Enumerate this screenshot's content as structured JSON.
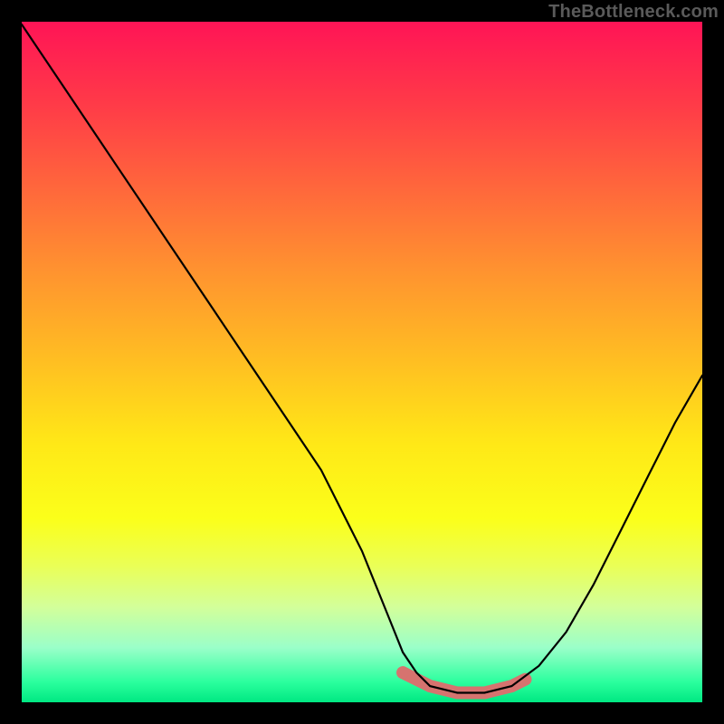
{
  "watermark": "TheBottleneck.com",
  "colors": {
    "background": "#000000",
    "curve": "#000000",
    "highlight": "#d6736f"
  },
  "chart_data": {
    "type": "line",
    "title": "",
    "xlabel": "",
    "ylabel": "",
    "xlim": [
      0,
      100
    ],
    "ylim": [
      0,
      100
    ],
    "grid": false,
    "series": [
      {
        "name": "bottleneck-curve",
        "x": [
          0,
          2,
          6,
          12,
          20,
          28,
          36,
          44,
          50,
          54,
          56,
          58,
          60,
          64,
          68,
          72,
          76,
          80,
          84,
          88,
          92,
          96,
          100
        ],
        "values": [
          100,
          97,
          91,
          82,
          70,
          58,
          46,
          34,
          22,
          12,
          7,
          4,
          2,
          1,
          1,
          2,
          5,
          10,
          17,
          25,
          33,
          41,
          48
        ]
      }
    ],
    "highlight": {
      "name": "optimal-range",
      "x": [
        56,
        60,
        64,
        68,
        72,
        74
      ],
      "values": [
        4,
        2,
        1,
        1,
        2,
        3
      ],
      "dot": {
        "x": 56,
        "y": 4
      }
    },
    "gradient_stops": [
      {
        "pos": 0.0,
        "color": "#ff1456"
      },
      {
        "pos": 0.25,
        "color": "#ff693b"
      },
      {
        "pos": 0.5,
        "color": "#ffbf22"
      },
      {
        "pos": 0.73,
        "color": "#fbff1a"
      },
      {
        "pos": 0.92,
        "color": "#9affc9"
      },
      {
        "pos": 1.0,
        "color": "#00e882"
      }
    ]
  }
}
